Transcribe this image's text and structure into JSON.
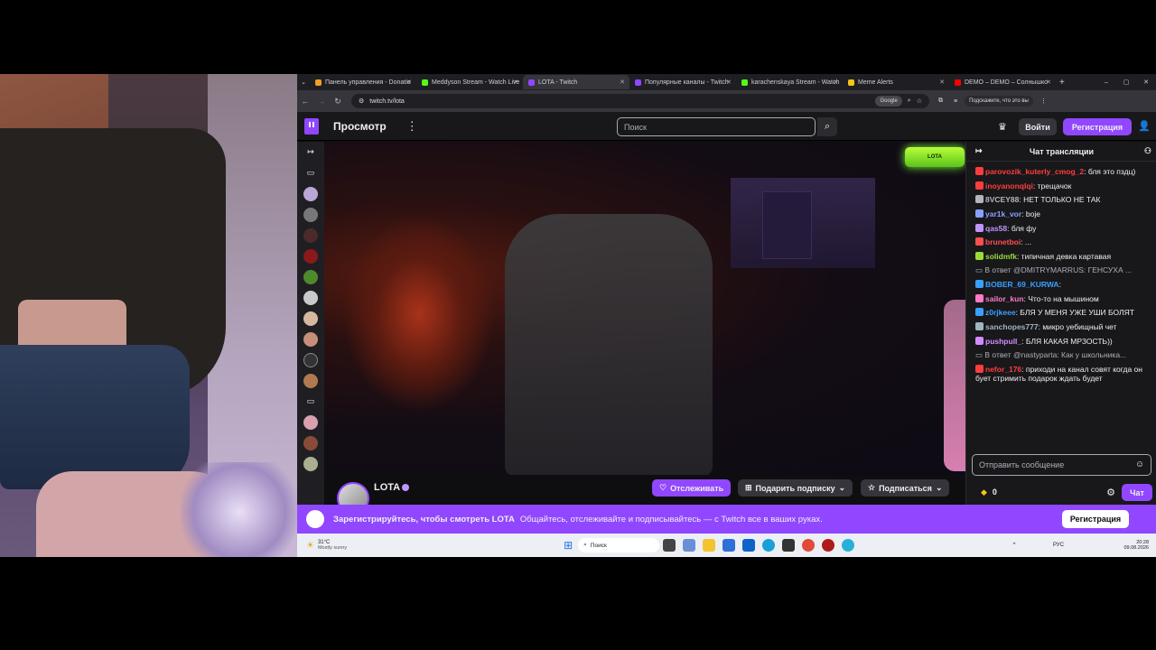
{
  "browser": {
    "tabs": [
      {
        "title": "Панель управления - Donatio",
        "color": "#f0a020"
      },
      {
        "title": "Meddyson Stream - Watch Live",
        "color": "#53fc18"
      },
      {
        "title": "LOTA - Twitch",
        "color": "#9147ff",
        "active": true
      },
      {
        "title": "Популярные каналы - Twitch",
        "color": "#9147ff"
      },
      {
        "title": "karachenskaya Stream - Watch",
        "color": "#53fc18"
      },
      {
        "title": "Meme Alerts",
        "color": "#f5c518"
      },
      {
        "title": "DEMO – DEMO – Солнышко",
        "color": "#ff0000"
      }
    ],
    "url": "twitch.tv/lota",
    "google_label": "Google",
    "profile_hint": "Подскажите, что это вы"
  },
  "twitch": {
    "browse_label": "Просмотр",
    "search_placeholder": "Поиск",
    "login_label": "Войти",
    "signup_label": "Регистрация",
    "channel": {
      "name": "LOTA",
      "follow_label": "Отслеживать",
      "gift_label": "Подарить подписку",
      "subscribe_label": "Подписаться",
      "overlay_sign": "LOTA"
    },
    "chat": {
      "title": "Чат трансляции",
      "input_placeholder": "Отправить сообщение",
      "points": "0",
      "chat_button": "Чат",
      "messages": [
        {
          "user": "parovozik_kuterly_cmog_2",
          "color": "#ff3d3d",
          "text": ": бля это пздц)"
        },
        {
          "user": "inoyanonqlqi",
          "color": "#ff3d3d",
          "text": ": трещачок"
        },
        {
          "user": "8VCEY88",
          "color": "#b4b4bd",
          "text": ": НЕТ ТОЛЬКО НЕ ТАК"
        },
        {
          "user": "yar1k_vor",
          "color": "#8aa0ff",
          "text": ": boje"
        },
        {
          "user": "qas58",
          "color": "#bf94ff",
          "text": ": бля фу"
        },
        {
          "user": "brunetboi",
          "color": "#ff4f4f",
          "text": ": ..."
        },
        {
          "user": "solidmfk",
          "color": "#9adb3a",
          "text": ": типичная девка картавая"
        },
        {
          "reply": "В ответ @DMITRYMARRUS: ГЕНСУХА ..."
        },
        {
          "user": "BOBER_69_KURWA",
          "color": "#3aa0ff",
          "text": ":"
        },
        {
          "user": "sailor_kun",
          "color": "#ff79c6",
          "text": ": Что-то на мышином"
        },
        {
          "user": "z0rjkeee",
          "color": "#3aa0ff",
          "text": ": БЛЯ У МЕНЯ УЖЕ УШИ БОЛЯТ"
        },
        {
          "user": "sanchopes777",
          "color": "#9fb5c0",
          "text": ": микро уебищный чет"
        },
        {
          "user": "pushpull_",
          "color": "#d28cff",
          "text": ": БЛЯ КАКАЯ МРЗОСТЬ))"
        },
        {
          "reply": "В ответ @nastyparta: Как у школьника..."
        },
        {
          "user": "nefor_176",
          "color": "#ff3d3d",
          "text": ": приходи на канал совят когда он бует стримить подарок ждать будет"
        }
      ]
    },
    "banner": {
      "headline": "Зарегистрируйтесь, чтобы смотреть LOTA",
      "text": "Общайтесь, отслеживайте и подписывайтесь — с Twitch все в ваших руках.",
      "button": "Регистрация"
    }
  },
  "taskbar": {
    "weather_temp": "31°C",
    "weather_desc": "Mostly sunny",
    "search_label": "Поиск",
    "lang": "РУС",
    "time": "20:28",
    "date": "09.08.2026"
  }
}
